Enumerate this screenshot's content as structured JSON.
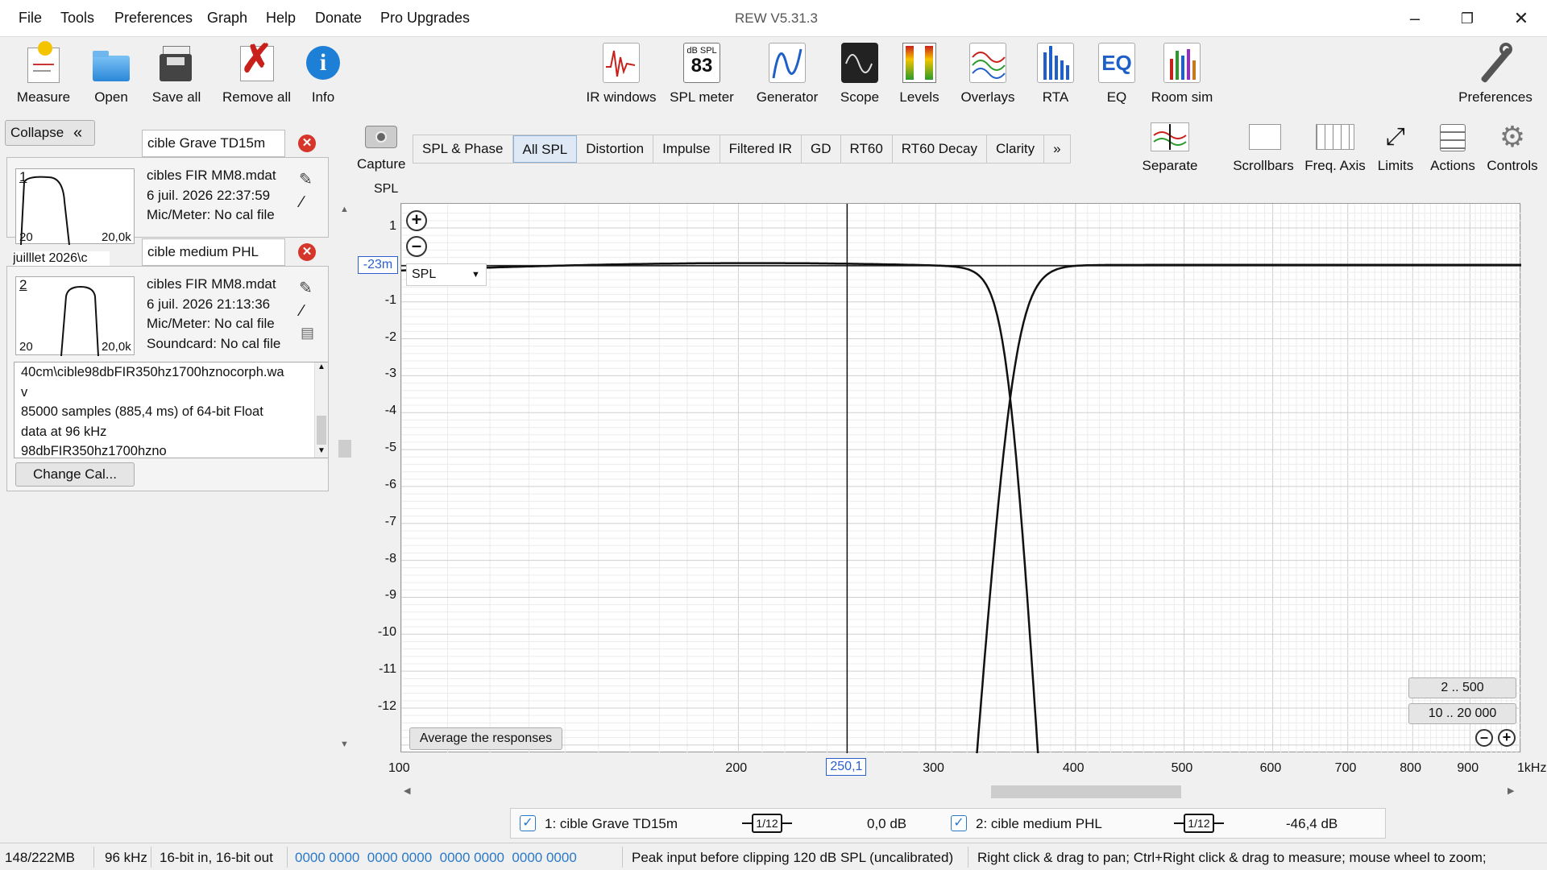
{
  "menu": [
    "File",
    "Tools",
    "Preferences",
    "Graph",
    "Help",
    "Donate",
    "Pro Upgrades"
  ],
  "window_title": "REW V5.31.3",
  "toolbar_left": [
    "Measure",
    "Open",
    "Save all",
    "Remove all",
    "Info"
  ],
  "toolbar_center": [
    "IR windows",
    "SPL meter",
    "Generator",
    "Scope",
    "Levels",
    "Overlays",
    "RTA",
    "EQ",
    "Room sim"
  ],
  "spl_meter_icon": {
    "top": "dB SPL",
    "value": "83"
  },
  "toolbar_right": "Preferences",
  "collapse_label": "Collapse",
  "measurements": [
    {
      "index": "1",
      "name": "cible Grave TD15m",
      "file": "cibles FIR MM8.mdat",
      "date": "6 juil. 2026 22:37:59",
      "mic": "Mic/Meter: No cal file",
      "thumb_left": "20",
      "thumb_right": "20,0k",
      "under": "juilllet 2026\\c"
    },
    {
      "index": "2",
      "name": "cible medium PHL",
      "file": "cibles FIR MM8.mdat",
      "date": "6 juil. 2026 21:13:36",
      "mic": "Mic/Meter: No cal file",
      "soundcard": "Soundcard: No cal file",
      "thumb_left": "20",
      "thumb_right": "20,0k"
    }
  ],
  "notes": [
    "40cm\\cible98dbFIR350hz1700hznocorph.wa",
    "v",
    "85000 samples (885,4 ms) of 64-bit Float",
    "data at 96 kHz",
    "98dbFIR350hz1700hzno"
  ],
  "change_cal": "Change Cal...",
  "capture_label": "Capture",
  "tabs": [
    "SPL & Phase",
    "All SPL",
    "Distortion",
    "Impulse",
    "Filtered IR",
    "GD",
    "RT60",
    "RT60 Decay",
    "Clarity",
    "»"
  ],
  "active_tab": "All SPL",
  "right_tools": [
    "Separate",
    "Scrollbars",
    "Freq. Axis",
    "Limits",
    "Actions",
    "Controls"
  ],
  "graph": {
    "y_axis_title": "SPL",
    "cursor_value": "-23m",
    "dropdown": "SPL",
    "average_button": "Average the responses",
    "range_buttons": [
      "2 .. 500",
      "10 .. 20 000"
    ],
    "cursor_freq": "250,1"
  },
  "chart_data": {
    "type": "line",
    "title": "",
    "xlabel": "",
    "ylabel": "SPL",
    "x_scale": "log",
    "xlim": [
      100,
      1000
    ],
    "ylim": [
      -13,
      1.5
    ],
    "y_ticks": [
      "1",
      "-23m",
      "-1",
      "-2",
      "-3",
      "-4",
      "-5",
      "-6",
      "-7",
      "-8",
      "-9",
      "-10",
      "-11",
      "-12"
    ],
    "x_ticks": [
      "100",
      "200",
      "250,1",
      "300",
      "400",
      "500",
      "600",
      "700",
      "800",
      "900",
      "1kHz"
    ],
    "series": [
      {
        "name": "1: cible Grave TD15m",
        "x": [
          100,
          200,
          250,
          300,
          330,
          350,
          380,
          400
        ],
        "y": [
          -0.15,
          0.08,
          0.05,
          -1.5,
          -4,
          -6,
          -10.5,
          -13
        ]
      },
      {
        "name": "2: cible medium PHL",
        "x": [
          330,
          350,
          380,
          400,
          450,
          500,
          700,
          1000
        ],
        "y": [
          -13,
          -6,
          -3,
          -1.5,
          -0.4,
          -0.15,
          -0.03,
          0
        ]
      }
    ]
  },
  "legend": {
    "items": [
      {
        "label": "1: cible Grave TD15m",
        "smoothing": "1/12",
        "offset": "0,0 dB"
      },
      {
        "label": "2: cible medium PHL",
        "smoothing": "1/12",
        "offset": "-46,4 dB"
      }
    ]
  },
  "status": {
    "memory": "148/222MB",
    "rate": "96 kHz",
    "bits": "16-bit in, 16-bit out",
    "levels": "0000 0000  0000 0000  0000 0000  0000 0000",
    "peak": "Peak input before clipping 120 dB SPL (uncalibrated)",
    "hint": "Right click & drag to pan; Ctrl+Right click & drag to measure; mouse wheel to zoom;"
  },
  "colors": {
    "accent": "#2a79c9",
    "close_red": "#d6352a"
  }
}
